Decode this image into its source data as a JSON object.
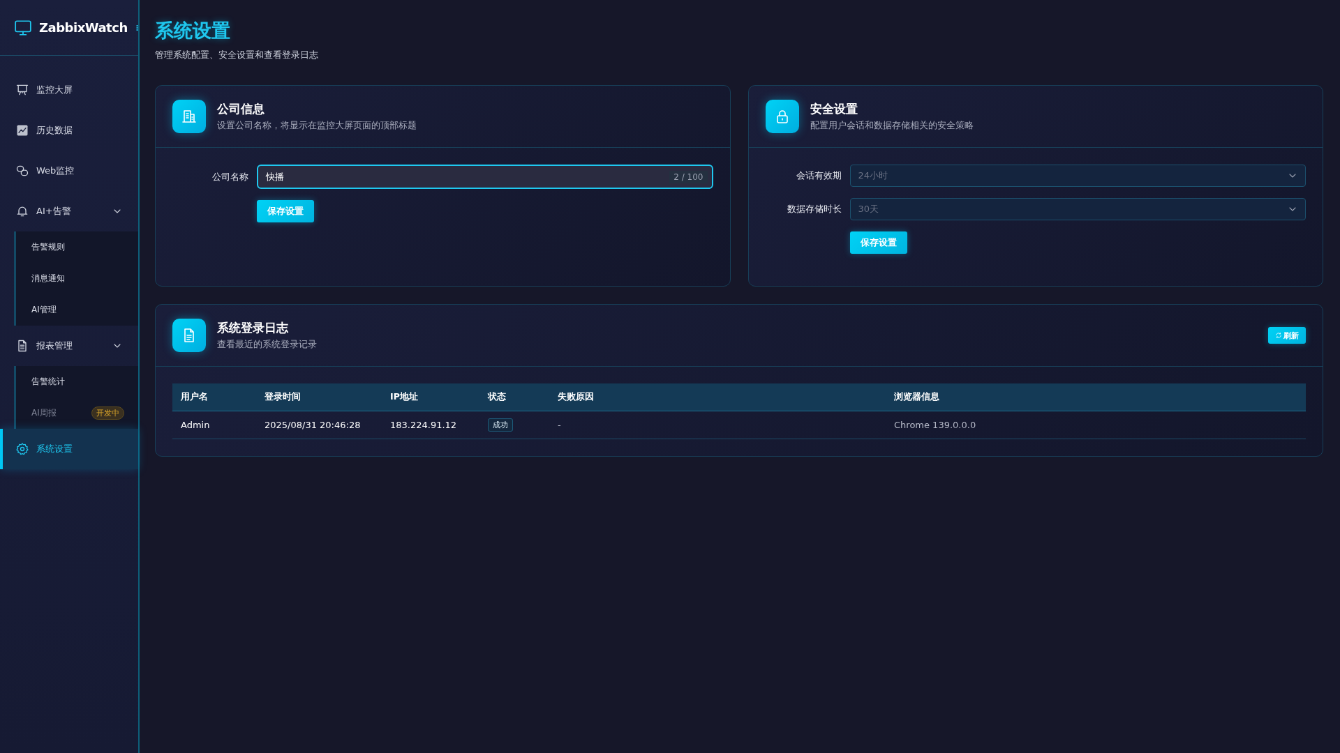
{
  "sidebar": {
    "brand": "ZabbixWatch",
    "items": [
      {
        "label": "监控大屏",
        "selected": false
      },
      {
        "label": "历史数据",
        "selected": false
      },
      {
        "label": "Web监控",
        "selected": false
      },
      {
        "label": "AI+告警",
        "selected": false,
        "expanded": true,
        "children": [
          {
            "label": "告警规则",
            "disabled": false
          },
          {
            "label": "消息通知",
            "disabled": false
          },
          {
            "label": "AI管理",
            "disabled": false
          }
        ]
      },
      {
        "label": "报表管理",
        "selected": false,
        "expanded": true,
        "children": [
          {
            "label": "告警统计",
            "disabled": false
          },
          {
            "label": "AI周报",
            "disabled": true,
            "badge": "开发中"
          }
        ]
      },
      {
        "label": "系统设置",
        "selected": true
      }
    ]
  },
  "page": {
    "title": "系统设置",
    "subtitle": "管理系统配置、安全设置和查看登录日志"
  },
  "company_card": {
    "title": "公司信息",
    "subtitle": "设置公司名称，将显示在监控大屏页面的顶部标题",
    "field": {
      "label": "公司名称",
      "value": "快播",
      "counter": "2 / 100"
    },
    "button": "保存设置"
  },
  "security_card": {
    "title": "安全设置",
    "subtitle": "配置用户会话和数据存储相关的安全策略",
    "selects": [
      {
        "label": "会话有效期",
        "value": "24小时"
      },
      {
        "label": "数据存储时长",
        "value": "30天"
      }
    ],
    "button": "保存设置"
  },
  "log_card": {
    "title": "系统登录日志",
    "subtitle": "查看最近的系统登录记录",
    "refresh": "刷新",
    "table": {
      "columns": [
        "用户名",
        "登录时间",
        "IP地址",
        "状态",
        "失败原因",
        "浏览器信息"
      ],
      "rows": [
        {
          "user": "Admin",
          "time": "2025/08/31 20:46:28",
          "ip": "183.224.91.12",
          "status": {
            "label": "成功",
            "kind": "success"
          },
          "reason": "-",
          "browser": "Chrome 139.0.0.0"
        }
      ]
    }
  }
}
